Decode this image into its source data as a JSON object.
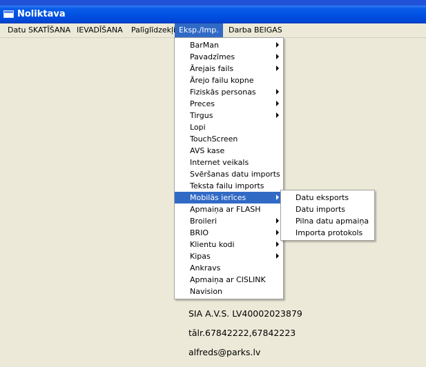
{
  "window": {
    "title": "Noliktava"
  },
  "menubar": {
    "items": [
      {
        "label": "Datu SKATĪŠANA"
      },
      {
        "label": "IEVADĪŠANA"
      },
      {
        "label": "Palīglīdzekļi"
      },
      {
        "label": "Eksp./Imp."
      },
      {
        "label": "Darba BEIGAS"
      }
    ]
  },
  "dropdown": {
    "items": [
      {
        "label": "BarMan"
      },
      {
        "label": "Pavadzīmes"
      },
      {
        "label": "Ārejais fails"
      },
      {
        "label": "Ārejo failu kopne"
      },
      {
        "label": "Fiziskās personas"
      },
      {
        "label": "Preces"
      },
      {
        "label": "Tirgus"
      },
      {
        "label": "Lopi"
      },
      {
        "label": "TouchScreen"
      },
      {
        "label": "AVS kase"
      },
      {
        "label": "Internet veikals"
      },
      {
        "label": "Svēršanas datu imports"
      },
      {
        "label": "Teksta failu imports"
      },
      {
        "label": "Mobilās ierīces"
      },
      {
        "label": "Apmaiņa ar FLASH"
      },
      {
        "label": "Broileri"
      },
      {
        "label": "BRIO"
      },
      {
        "label": "Klientu kodi"
      },
      {
        "label": "Kipas"
      },
      {
        "label": "Ankravs"
      },
      {
        "label": "Apmaiņa ar CISLINK"
      },
      {
        "label": "Navision"
      }
    ]
  },
  "submenu": {
    "items": [
      {
        "label": "Datu eksports"
      },
      {
        "label": "Datu imports"
      },
      {
        "label": "Pilna datu apmaiņa"
      },
      {
        "label": "Importa protokols"
      }
    ]
  },
  "info": {
    "company": "SIA A.V.S. LV40002023879",
    "phone": "tālr.67842222,67842223",
    "email": "alfreds@parks.lv"
  },
  "colors": {
    "highlight": "#316ac5",
    "titlebar": "#0052e3",
    "background": "#ece9d8"
  }
}
